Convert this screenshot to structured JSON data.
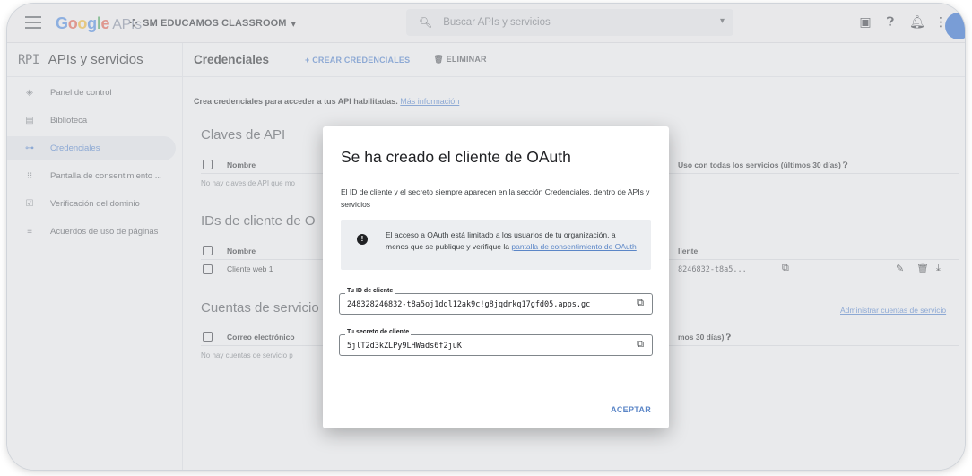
{
  "topbar": {
    "logo_google": [
      "G",
      "o",
      "o",
      "g",
      "l",
      "e"
    ],
    "logo_apis": "APIs",
    "project": "SM EDUCAMOS CLASSROOM",
    "search_placeholder": "Buscar APIs y servicios"
  },
  "sidebar": {
    "api_label": "RPI",
    "title": "APIs y servicios",
    "items": [
      {
        "label": "Panel de control",
        "icon": "dashboard-icon"
      },
      {
        "label": "Biblioteca",
        "icon": "library-icon"
      },
      {
        "label": "Credenciales",
        "icon": "key-icon"
      },
      {
        "label": "Pantalla de consentimiento ...",
        "icon": "consent-icon"
      },
      {
        "label": "Verificación del dominio",
        "icon": "domain-icon"
      },
      {
        "label": "Acuerdos de uso de páginas",
        "icon": "agreements-icon"
      }
    ],
    "active_index": 2
  },
  "main": {
    "title": "Credenciales",
    "create_label": "+ CREAR CREDENCIALES",
    "delete_label": "ELIMINAR",
    "intro_text": "Crea credenciales para acceder a tus API habilitadas.",
    "intro_link": "Más información",
    "api_keys": {
      "title": "Claves de API",
      "col_name": "Nombre",
      "col_usage": "Uso con todas los servicios (últimos 30 días)",
      "empty": "No hay claves de API que mo"
    },
    "oauth": {
      "title": "IDs de cliente de O",
      "col_name": "Nombre",
      "col_client": "liente",
      "row_name": "Cliente web 1",
      "row_client": "8246832-t8a5..."
    },
    "service_accounts": {
      "title": "Cuentas de servicio",
      "col_email": "Correo electrónico",
      "col_usage": "mos 30 días)",
      "empty": "No hay cuentas de servicio p",
      "manage_link": "Administrar cuentas de servicio"
    }
  },
  "dialog": {
    "title": "Se ha creado el cliente de OAuth",
    "description": "El ID de cliente y el secreto siempre aparecen en la sección Credenciales, dentro de APIs y servicios",
    "info_text": "El acceso a OAuth está limitado a los usuarios de tu organización, a menos que se publique y verifique la",
    "info_link": "pantalla de consentimiento de OAuth",
    "client_id_label": "Tu ID de cliente",
    "client_id_value": "248328246832-t8a5oj1dql12ak9c!g8jqdrkq17gfd05.apps.gc",
    "secret_label": "Tu secreto de cliente",
    "secret_value": "5jlT2d3kZLPy9LHWads6f2juK",
    "accept_label": "ACEPTAR"
  }
}
